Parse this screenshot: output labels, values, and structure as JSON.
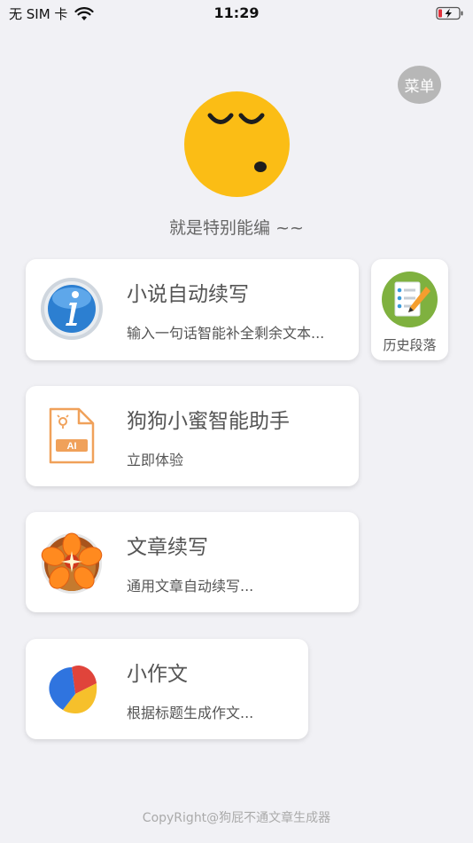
{
  "status_bar": {
    "carrier": "无 SIM 卡",
    "time": "11:29"
  },
  "menu": {
    "label": "菜单"
  },
  "avatar": {
    "icon": "sleepy-face-emoji",
    "color": "#fbbd15"
  },
  "tagline": "就是特别能编 ~~",
  "cards": [
    {
      "title": "小说自动续写",
      "subtitle": "输入一句话智能补全剩余文本...",
      "icon": "info-icon"
    },
    {
      "title": "狗狗小蜜智能助手",
      "subtitle": "立即体验",
      "icon": "ai-file-icon"
    },
    {
      "title": "文章续写",
      "subtitle": "通用文章自动续写...",
      "icon": "flower-icon"
    },
    {
      "title": "小作文",
      "subtitle": "根据标题生成作文...",
      "icon": "pie-chart-icon"
    }
  ],
  "history": {
    "label": "历史段落",
    "icon": "notepad-pen-icon"
  },
  "footer": "CopyRight@狗屁不通文章生成器"
}
